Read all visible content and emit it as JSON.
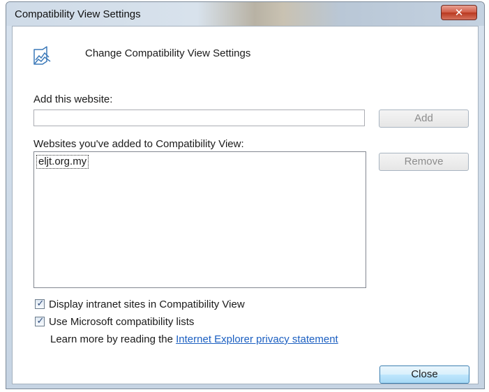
{
  "window": {
    "title": "Compatibility View Settings",
    "close_glyph": "✕"
  },
  "header": {
    "icon": "compatibility-view-icon",
    "text": "Change Compatibility View Settings"
  },
  "add_section": {
    "label": "Add this website:",
    "input_value": "",
    "button_label": "Add"
  },
  "list_section": {
    "label": "Websites you've added to Compatibility View:",
    "items": [
      "eljt.org.my"
    ],
    "remove_label": "Remove"
  },
  "options": [
    {
      "label": "Display intranet sites in Compatibility View",
      "checked": true
    },
    {
      "label": "Use Microsoft compatibility lists",
      "checked": true
    }
  ],
  "learn_more": {
    "prefix": "Learn more by reading the ",
    "link_text": "Internet Explorer privacy statement"
  },
  "footer": {
    "close_label": "Close"
  },
  "colors": {
    "link": "#1b5fc1",
    "close_button_red": "#cf5a44",
    "accent_blue": "#3c7fb1"
  }
}
